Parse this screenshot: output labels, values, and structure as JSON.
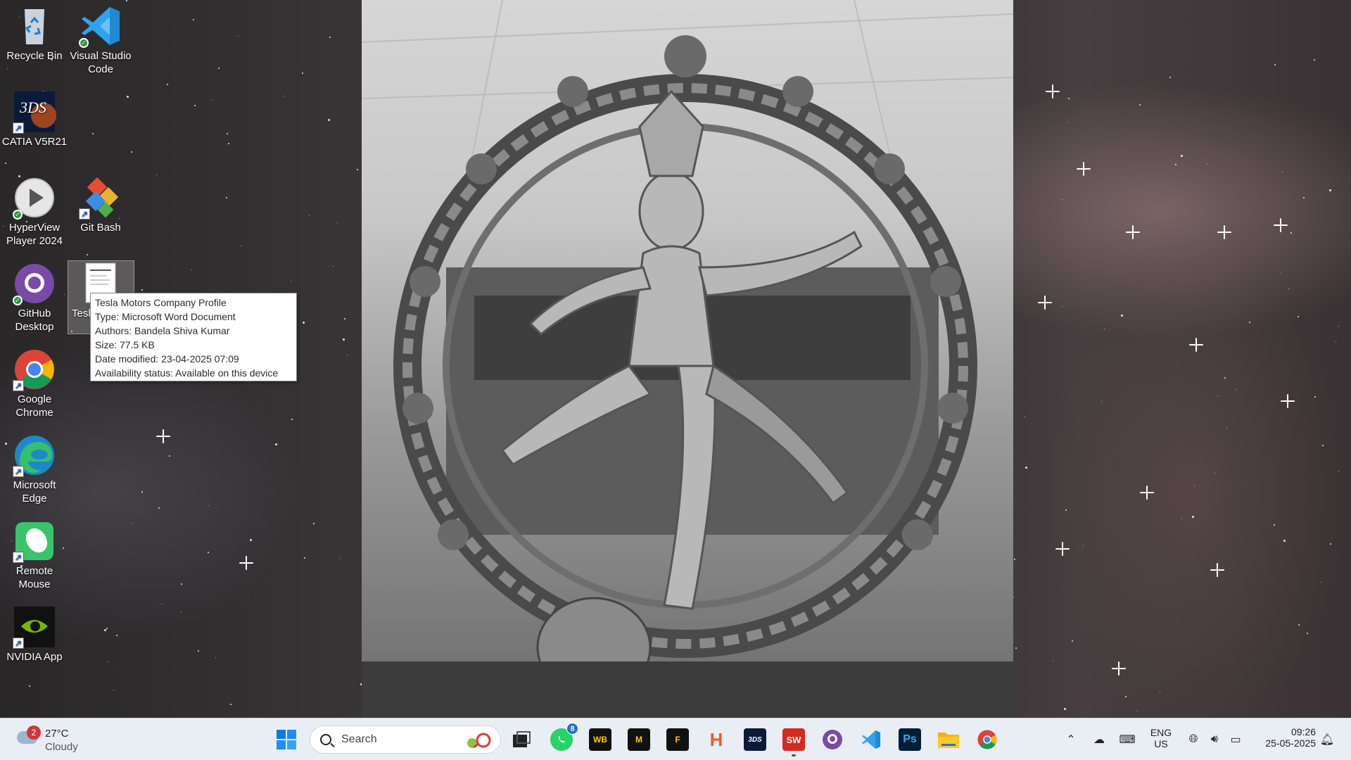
{
  "desktop": {
    "icons": [
      {
        "label": "Recycle Bin"
      },
      {
        "label": "Visual Studio Code"
      },
      {
        "label": "CATIA V5R21"
      },
      {
        "label": "HyperView Player 2024"
      },
      {
        "label": "Git Bash"
      },
      {
        "label": "GitHub Desktop"
      },
      {
        "label": "Tesl Com"
      },
      {
        "label": "Google Chrome"
      },
      {
        "label": "Microsoft Edge"
      },
      {
        "label": "Remote Mouse"
      },
      {
        "label": "NVIDIA App"
      }
    ]
  },
  "tooltip": {
    "title": "Tesla Motors Company Profile",
    "type": "Type: Microsoft Word Document",
    "authors": "Authors: Bandela Shiva Kumar",
    "size": "Size: 77.5 KB",
    "modified": "Date modified: 23-04-2025 07:09",
    "availability": "Availability status: Available on this device"
  },
  "taskbar": {
    "weather": {
      "badge": "2",
      "temp": "27°C",
      "condition": "Cloudy"
    },
    "search_placeholder": "Search",
    "apps": [
      {
        "name": "start-icon"
      },
      {
        "name": "task-view-icon"
      },
      {
        "name": "whatsapp-icon",
        "badge": "8"
      },
      {
        "name": "ansys-workbench-icon",
        "text": "WB"
      },
      {
        "name": "ansys-mechanical-icon",
        "text": "M"
      },
      {
        "name": "ansys-fluent-icon",
        "text": "F"
      },
      {
        "name": "hypermesh-icon",
        "text": "H"
      },
      {
        "name": "catia-icon",
        "text": "3DS"
      },
      {
        "name": "solidworks-icon",
        "text": "SW"
      },
      {
        "name": "github-desktop-icon"
      },
      {
        "name": "vscode-icon"
      },
      {
        "name": "photoshop-icon",
        "text": "Ps"
      },
      {
        "name": "file-explorer-icon"
      },
      {
        "name": "chrome-icon"
      }
    ],
    "tray": {
      "lang_top": "ENG",
      "lang_bottom": "US",
      "time": "09:26",
      "date": "25-05-2025"
    }
  },
  "colors": {
    "taskbar_bg": "#e9eef4",
    "accent_blue": "#0078d4",
    "badge_red": "#d13438"
  }
}
